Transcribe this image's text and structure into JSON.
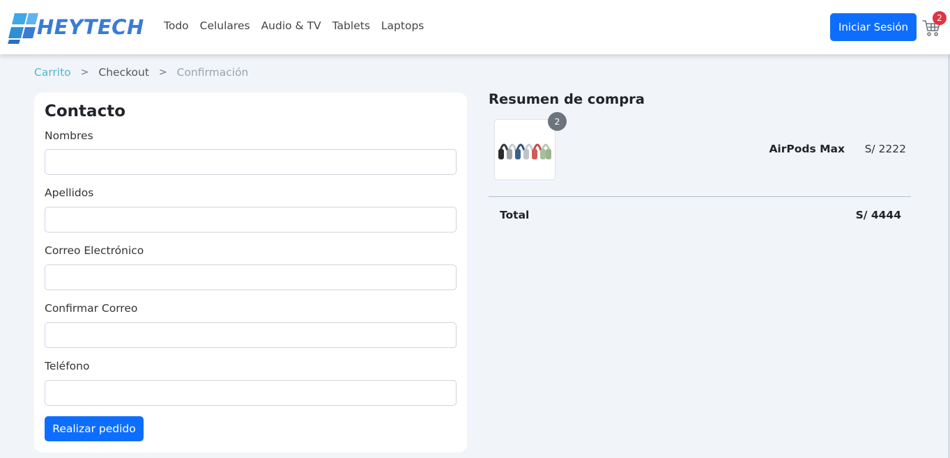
{
  "brand": {
    "name": "HEYTECH",
    "accent": "#3a7bd5"
  },
  "nav": {
    "links": [
      "Todo",
      "Celulares",
      "Audio & TV",
      "Tablets",
      "Laptops"
    ],
    "login_label": "Iniciar Sesión",
    "cart_icon": "shopping-cart-icon",
    "cart_count": "2"
  },
  "breadcrumb": {
    "items": [
      "Carrito",
      "Checkout",
      "Confirmación"
    ],
    "separator": ">"
  },
  "contact": {
    "title": "Contacto",
    "fields": [
      {
        "label": "Nombres",
        "value": ""
      },
      {
        "label": "Apellidos",
        "value": ""
      },
      {
        "label": "Correo Electrónico",
        "value": ""
      },
      {
        "label": "Confirmar Correo",
        "value": ""
      },
      {
        "label": "Teléfono",
        "value": ""
      }
    ],
    "submit_label": "Realizar pedido"
  },
  "summary": {
    "title": "Resumen de compra",
    "items": [
      {
        "name": "AirPods Max",
        "price": "S/ 2222",
        "quantity": "2"
      }
    ],
    "total_label": "Total",
    "total_value": "S/ 4444"
  },
  "colors": {
    "primary_button": "#0d6efd",
    "cart_badge": "#dc3545",
    "breadcrumb_link": "#4fb6cf",
    "page_background": "#f1f5f9"
  }
}
